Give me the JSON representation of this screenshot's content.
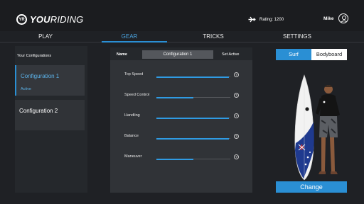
{
  "header": {
    "logo_mark": "YR",
    "logo_bold": "YOU",
    "logo_light": "RIDING",
    "rating_label": "Rating: 1200",
    "username": "Mike"
  },
  "tabs": [
    {
      "label": "PLAY",
      "active": false
    },
    {
      "label": "GEAR",
      "active": true
    },
    {
      "label": "TRICKS",
      "active": false
    },
    {
      "label": "SETTINGS",
      "active": false
    }
  ],
  "configurations": {
    "heading": "Your Configurations",
    "items": [
      {
        "name": "Configuration 1",
        "status": "Active"
      },
      {
        "name": "Configuration 2",
        "status": ""
      }
    ]
  },
  "editor": {
    "name_label": "Name",
    "name_value": "Configuration 1",
    "set_active_label": "Set Active",
    "stats": [
      {
        "label": "Top Speed",
        "value": 0.98
      },
      {
        "label": "Speed Control",
        "value": 0.5
      },
      {
        "label": "Handling",
        "value": 0.98
      },
      {
        "label": "Balance",
        "value": 0.98
      },
      {
        "label": "Maneuver",
        "value": 0.5
      }
    ]
  },
  "board_type": {
    "options": [
      "Surf",
      "Bodyboard"
    ],
    "selected": "Surf"
  },
  "change_label": "Change",
  "colors": {
    "accent": "#2a8fd4",
    "background": "#1f2125",
    "panel": "#303337"
  }
}
